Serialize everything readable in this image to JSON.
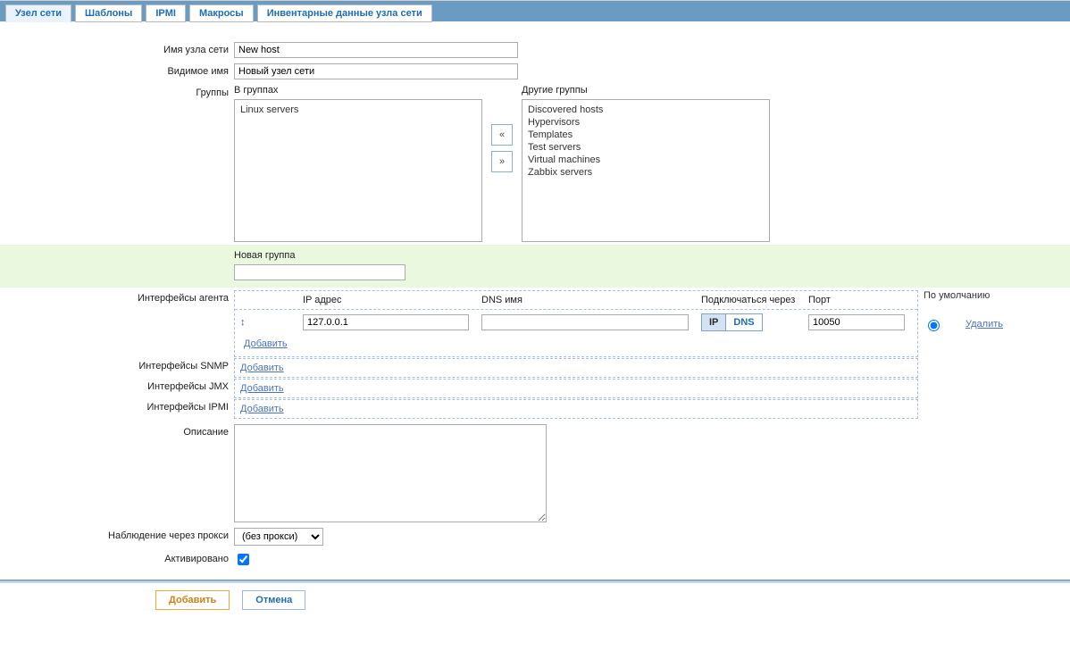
{
  "tabs": {
    "host": "Узел сети",
    "templates": "Шаблоны",
    "ipmi": "IPMI",
    "macros": "Макросы",
    "inventory": "Инвентарные данные узла сети"
  },
  "labels": {
    "hostname": "Имя узла сети",
    "visible_name": "Видимое имя",
    "groups": "Группы",
    "in_groups": "В группах",
    "other_groups": "Другие группы",
    "new_group": "Новая группа",
    "agent_if": "Интерфейсы агента",
    "snmp_if": "Интерфейсы SNMP",
    "jmx_if": "Интерфейсы JMX",
    "ipmi_if": "Интерфейсы IPMI",
    "description": "Описание",
    "monitored_proxy": "Наблюдение через прокси",
    "enabled": "Активировано",
    "ip_addr": "IP адрес",
    "dns_name": "DNS имя",
    "connect_via": "Подключаться через",
    "port": "Порт",
    "default": "По умолчанию",
    "ip": "IP",
    "dns": "DNS",
    "add": "Добавить",
    "delete": "Удалить",
    "move_left": "«",
    "move_right": "»"
  },
  "values": {
    "hostname": "New host",
    "visible_name": "Новый узел сети",
    "new_group": "",
    "description": "",
    "enabled": true
  },
  "groups_in": [
    "Linux servers"
  ],
  "groups_other": [
    "Discovered hosts",
    "Hypervisors",
    "Templates",
    "Test servers",
    "Virtual machines",
    "Zabbix servers"
  ],
  "agent_interface": {
    "ip": "127.0.0.1",
    "dns": "",
    "connect_via": "IP",
    "port": "10050",
    "default": true
  },
  "proxy": {
    "selected": "(без прокси)",
    "options": [
      "(без прокси)"
    ]
  },
  "footer": {
    "submit": "Добавить",
    "cancel": "Отмена"
  }
}
